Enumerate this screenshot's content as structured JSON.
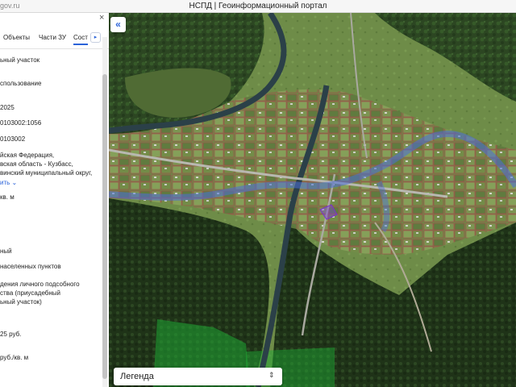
{
  "window": {
    "url_fragment": "gov.ru",
    "title": "НСПД | Геоинформационный портал"
  },
  "panel": {
    "close_glyph": "×",
    "tabs": [
      "Объекты",
      "Части ЗУ",
      "Сост"
    ],
    "next_tab_glyph": "▸",
    "fields": [
      "ьный участок",
      "спользование",
      "2025",
      "0103002:1056",
      "0103002",
      "йская Федерация,\nвская область - Кузбасс,\nвинский муниципальный округ,",
      "кв. м",
      "ный",
      "населенных пунктов",
      "дения личного подсобного\nства (приусадебный\nьный участок)",
      "25 руб.",
      "руб./кв. м"
    ],
    "more_link": "ить ⌄"
  },
  "map": {
    "collapse_glyph": "«",
    "legend": {
      "label": "Легенда",
      "arrows": "⌃\n⌄"
    }
  },
  "colors": {
    "accent": "#2b63d9",
    "forest_dark": "#2d4a24",
    "field": "#6d8a4a",
    "river": "#2b4048",
    "parcel_boundary": "#b43a3a",
    "water_zone": "#4a6ed8",
    "green_zone": "#3cb84a"
  }
}
